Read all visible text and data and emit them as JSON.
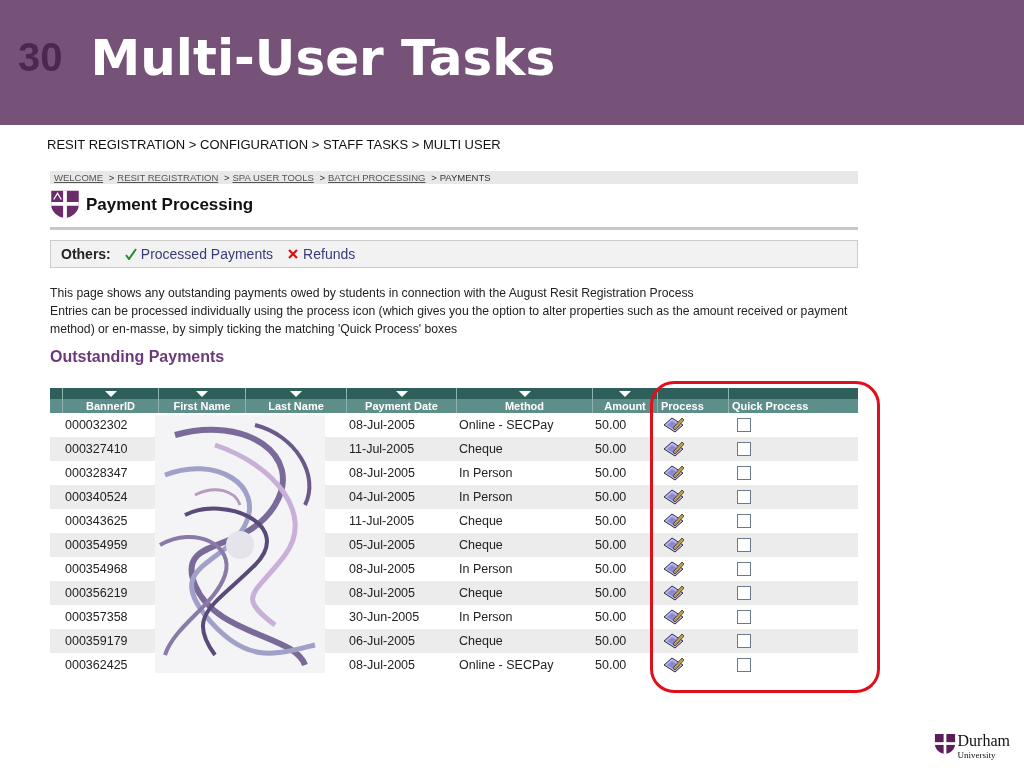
{
  "slide": {
    "number": "30",
    "title": "Multi-User Tasks",
    "path": "RESIT REGISTRATION > CONFIGURATION > STAFF TASKS > MULTI USER"
  },
  "screenshot": {
    "separator": ">",
    "crumbs": [
      {
        "label": "WELCOME",
        "link": true
      },
      {
        "label": "RESIT REGISTRATION",
        "link": true
      },
      {
        "label": "SPA USER TOOLS",
        "link": true
      },
      {
        "label": "BATCH PROCESSING",
        "link": true
      },
      {
        "label": "PAYMENTS",
        "link": false
      }
    ],
    "page_title": "Payment Processing",
    "others": {
      "label": "Others:",
      "links": [
        {
          "kind": "check",
          "label": "Processed Payments"
        },
        {
          "kind": "cross",
          "label": "Refunds"
        }
      ]
    },
    "description": [
      "This page shows any outstanding payments owed by students in connection with the August Resit Registration Process",
      "Entries can be processed individually using the process icon (which gives you the option to alter properties such as the amount received or payment method) or en-masse, by simply ticking the matching 'Quick Process' boxes"
    ],
    "section_title": "Outstanding Payments",
    "table": {
      "columns": [
        {
          "label": "BannerID",
          "sortable": true
        },
        {
          "label": "First Name",
          "sortable": true
        },
        {
          "label": "Last Name",
          "sortable": true
        },
        {
          "label": "Payment Date",
          "sortable": true
        },
        {
          "label": "Method",
          "sortable": true
        },
        {
          "label": "Amount",
          "sortable": true
        },
        {
          "label": "Process",
          "sortable": false
        },
        {
          "label": "Quick Process",
          "sortable": false
        }
      ],
      "rows": [
        {
          "banner_id": "000032302",
          "payment_date": "08-Jul-2005",
          "method": "Online - SECPay",
          "amount": "50.00",
          "quick_process": false
        },
        {
          "banner_id": "000327410",
          "payment_date": "11-Jul-2005",
          "method": "Cheque",
          "amount": "50.00",
          "quick_process": false
        },
        {
          "banner_id": "000328347",
          "payment_date": "08-Jul-2005",
          "method": "In Person",
          "amount": "50.00",
          "quick_process": false
        },
        {
          "banner_id": "000340524",
          "payment_date": "04-Jul-2005",
          "method": "In Person",
          "amount": "50.00",
          "quick_process": false
        },
        {
          "banner_id": "000343625",
          "payment_date": "11-Jul-2005",
          "method": "Cheque",
          "amount": "50.00",
          "quick_process": false
        },
        {
          "banner_id": "000354959",
          "payment_date": "05-Jul-2005",
          "method": "Cheque",
          "amount": "50.00",
          "quick_process": false
        },
        {
          "banner_id": "000354968",
          "payment_date": "08-Jul-2005",
          "method": "In Person",
          "amount": "50.00",
          "quick_process": false
        },
        {
          "banner_id": "000356219",
          "payment_date": "08-Jul-2005",
          "method": "Cheque",
          "amount": "50.00",
          "quick_process": false
        },
        {
          "banner_id": "000357358",
          "payment_date": "30-Jun-2005",
          "method": "In Person",
          "amount": "50.00",
          "quick_process": false
        },
        {
          "banner_id": "000359179",
          "payment_date": "06-Jul-2005",
          "method": "Cheque",
          "amount": "50.00",
          "quick_process": false
        },
        {
          "banner_id": "000362425",
          "payment_date": "08-Jul-2005",
          "method": "Online - SECPay",
          "amount": "50.00",
          "quick_process": false
        }
      ]
    }
  },
  "logo": {
    "name": "Durham",
    "subtitle": "University"
  }
}
